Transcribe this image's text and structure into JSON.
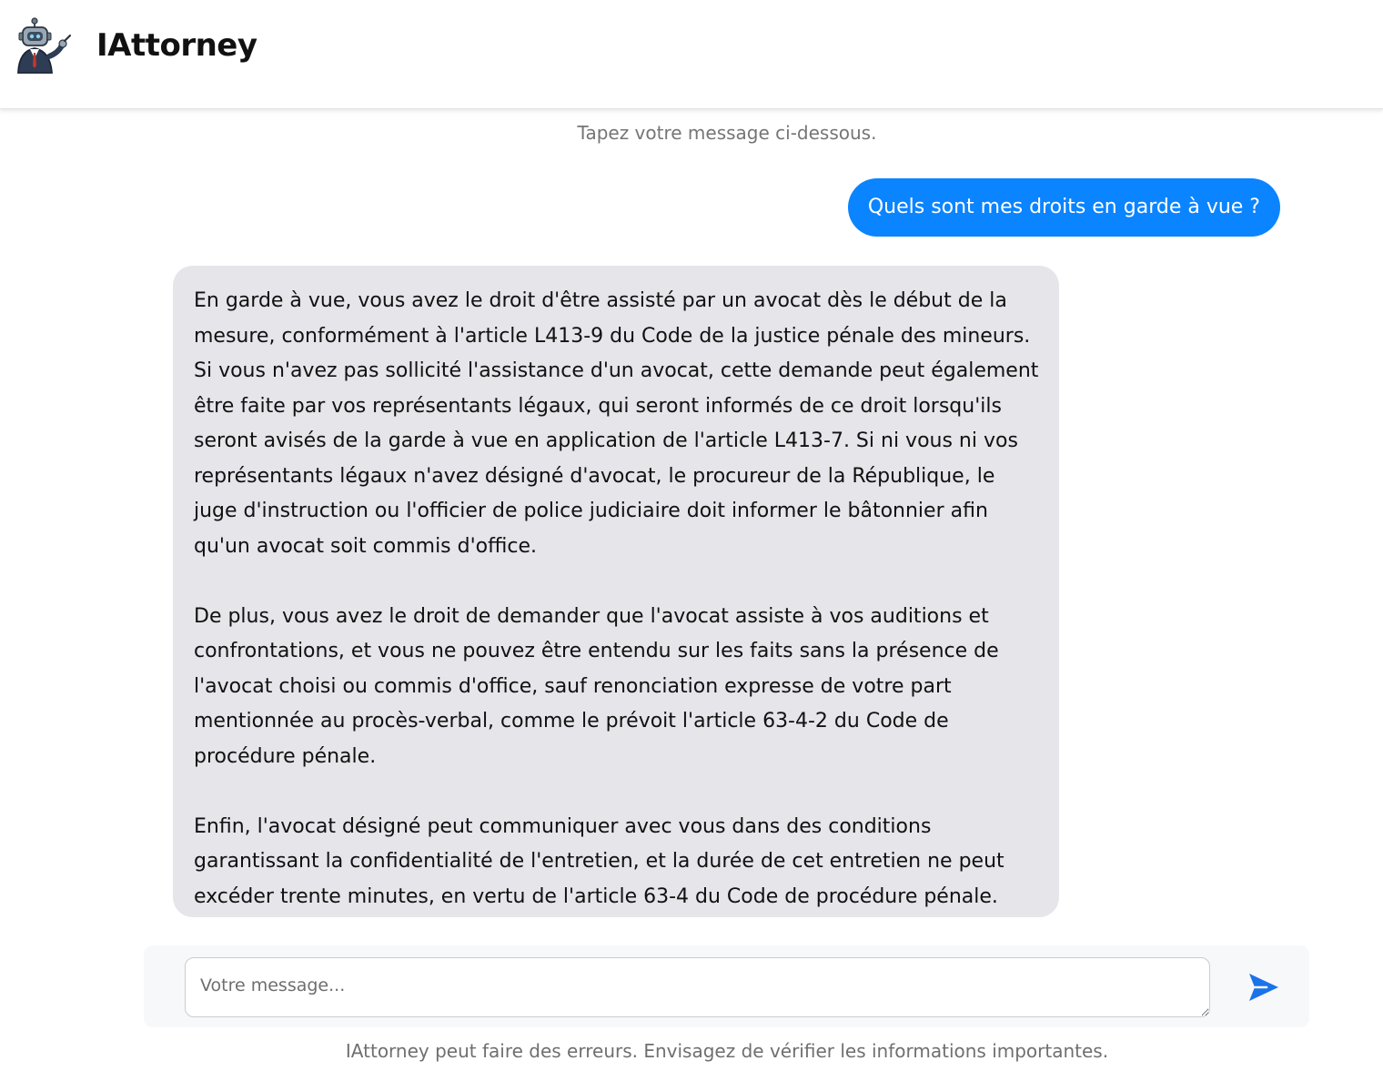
{
  "header": {
    "app_title": "IAttorney",
    "logo_icon": "robot-lawyer-icon"
  },
  "chat": {
    "hint": "Tapez votre message ci-dessous.",
    "messages": [
      {
        "role": "user",
        "text": "Quels sont mes droits en garde à vue ?"
      },
      {
        "role": "assistant",
        "paragraphs": [
          "En garde à vue, vous avez le droit d'être assisté par un avocat dès le début de la mesure, conformément à l'article L413-9 du Code de la justice pénale des mineurs. Si vous n'avez pas sollicité l'assistance d'un avocat, cette demande peut également être faite par vos représentants légaux, qui seront informés de ce droit lorsqu'ils seront avisés de la garde à vue en application de l'article L413-7. Si ni vous ni vos représentants légaux n'avez désigné d'avocat, le procureur de la République, le juge d'instruction ou l'officier de police judiciaire doit informer le bâtonnier afin qu'un avocat soit commis d'office.",
          "De plus, vous avez le droit de demander que l'avocat assiste à vos auditions et confrontations, et vous ne pouvez être entendu sur les faits sans la présence de l'avocat choisi ou commis d'office, sauf renonciation expresse de votre part mentionnée au procès-verbal, comme le prévoit l'article 63-4-2 du Code de procédure pénale.",
          "Enfin, l'avocat désigné peut communiquer avec vous dans des conditions garantissant la confidentialité de l'entretien, et la durée de cet entretien ne peut excéder trente minutes, en vertu de l'article 63-4 du Code de procédure pénale."
        ]
      }
    ]
  },
  "composer": {
    "placeholder": "Votre message...",
    "value": "",
    "send_icon": "send-icon"
  },
  "footer": {
    "disclaimer": "IAttorney peut faire des erreurs. Envisagez de vérifier les informations importantes."
  },
  "colors": {
    "user_bubble": "#0b84ff",
    "assistant_bubble": "#e5e5ea",
    "send_icon": "#1a73e8",
    "composer_bg": "#f7f8fa"
  }
}
